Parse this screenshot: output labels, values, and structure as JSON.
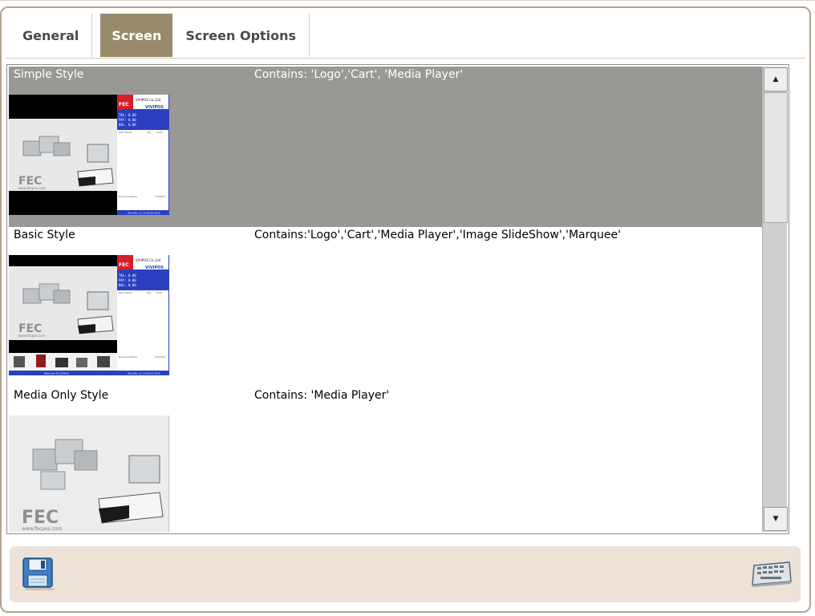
{
  "tabs": [
    {
      "label": "General"
    },
    {
      "label": "Screen"
    },
    {
      "label": "Screen Options"
    }
  ],
  "active_tab": "Screen",
  "styles": [
    {
      "name": "Simple Style",
      "contains": "Contains: 'Logo','Cart', 'Media Player'",
      "selected": true,
      "thumb": {
        "type": "cart",
        "brand": "FEC",
        "company": "VIVIPOS Co.,Ltd",
        "product": "VIVIPOS",
        "ttl": "TAL: 0.00",
        "pay": "PAY: 0.00",
        "bal": "BAL: 0.00",
        "item_col": "Item Name",
        "qty_col": "Qty",
        "sub_col": "Subt",
        "discount": "Discount Name",
        "subtotal": "Subtotal",
        "footer": "Wed Mar 11 14:00:00 2015",
        "logo_text": "FEC",
        "url": "www.fecpos.com"
      }
    },
    {
      "name": "Basic Style",
      "contains": "Contains:'Logo','Cart','Media Player','Image SlideShow','Marquee'",
      "selected": false,
      "thumb": {
        "type": "cart-marquee",
        "brand": "FEC",
        "company": "VIVIPOS Co.,Ltd",
        "product": "VIVIPOS",
        "ttl": "TAL: 0.00",
        "pay": "PAY: 0.00",
        "bal": "BAL: 0.00",
        "item_col": "Item Name",
        "qty_col": "Qty",
        "sub_col": "Subt",
        "discount": "Discount Name",
        "subtotal": "Subtotal",
        "footer": "Wed Mar 11 14:00:01 2015",
        "marquee": "Welcome To VIVIPOS",
        "logo_text": "FEC",
        "url": "www.fecpos.com"
      }
    },
    {
      "name": "Media Only Style",
      "contains": "Contains: 'Media Player'",
      "selected": false,
      "thumb": {
        "type": "media",
        "logo_text": "FEC",
        "url": "www.fecpos.com"
      }
    }
  ],
  "colors": {
    "selected_row": "#9a9894",
    "active_tab": "#9a8a6c",
    "footer_bg": "#ede2d7",
    "frame_border": "#b3a48d",
    "fec_red": "#d4202a",
    "cart_blue": "#2a3fbf"
  },
  "icons": {
    "save": "floppy-disk-icon",
    "keyboard": "keyboard-icon",
    "scroll_up": "triangle-up",
    "scroll_down": "triangle-down"
  },
  "scroll_labels": {
    "up": "▲",
    "down": "▼"
  }
}
